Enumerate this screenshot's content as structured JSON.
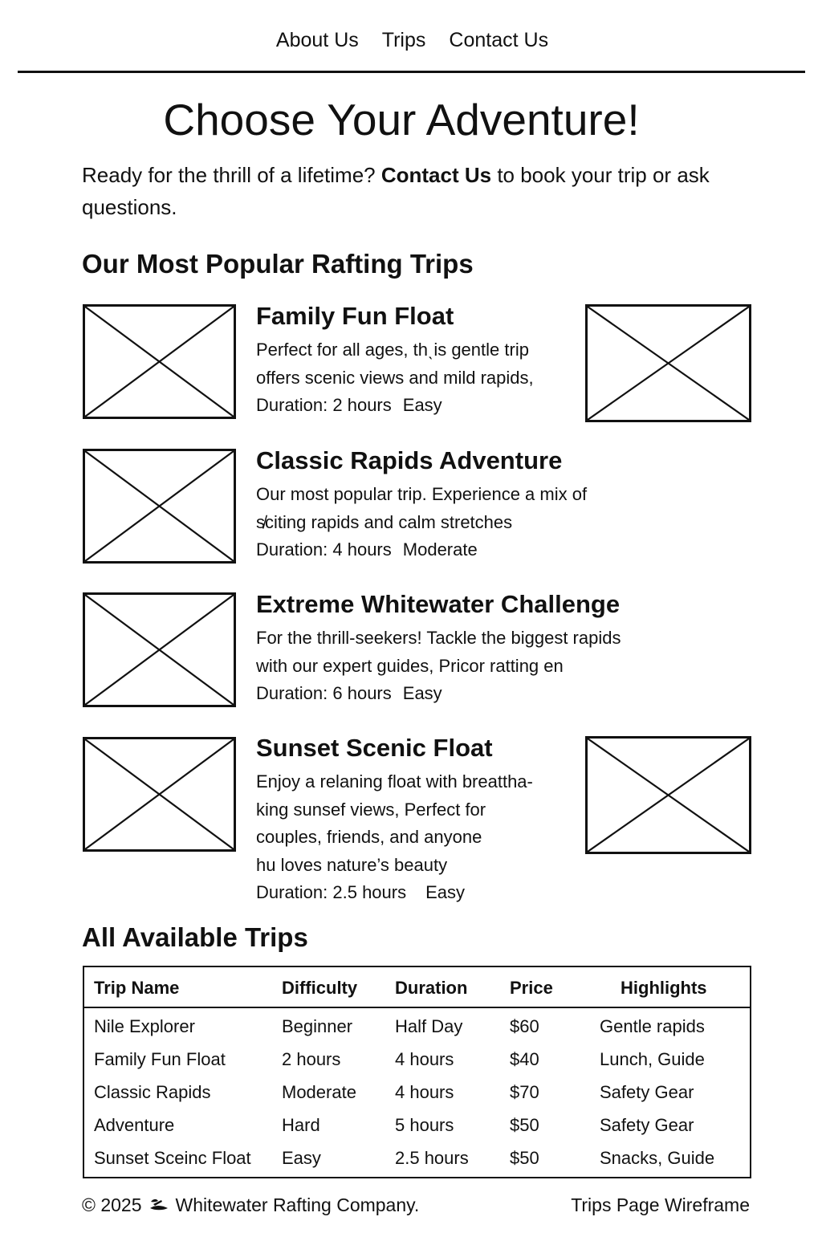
{
  "nav": {
    "items": [
      {
        "label": "About Us"
      },
      {
        "label": "Trips"
      },
      {
        "label": "Contact Us"
      }
    ]
  },
  "page": {
    "title": "Choose Your Adventure!",
    "intro_before": "Ready for the thrill of a lifetime? ",
    "intro_link": "Contact Us",
    "intro_after": " to book your trip or ask questions."
  },
  "popular": {
    "heading": "Our Most Popular Rafting Trips",
    "trips": [
      {
        "title": "Family Fun Float",
        "lines": [
          "Perfect for all ages, thˎis gentle trip",
          "offers scenic views and mild rapids,"
        ],
        "duration": "Duration: 2 hours",
        "difficulty": "Easy"
      },
      {
        "title": "Classic Rapids Adventure",
        "lines": [
          "Our most popular trip. Experience a mix of",
          "s̸citing rapids and calm stretches"
        ],
        "duration": "Duration: 4 hours",
        "difficulty": "Moderate"
      },
      {
        "title": "Extreme Whitewater Challenge",
        "lines": [
          "For the thrill-seekers! Tackle the biggest rapids",
          "with our expert guides, Pricor ratting en"
        ],
        "duration": "Duration: 6 hours",
        "difficulty": "Easy"
      },
      {
        "title": "Sunset Scenic Float",
        "lines": [
          "Enjoy a relaning float with breattha-",
          "king sunsef views, Perfect for",
          "couples, friends, and anyone",
          "hu loves nature’s beauty"
        ],
        "duration": "Duration: 2.5 hours",
        "difficulty": "Easy"
      }
    ]
  },
  "all_trips": {
    "heading": "All Available Trips",
    "columns": [
      "Trip Name",
      "Difficulty",
      "Duration",
      "Price",
      "Highlights"
    ],
    "rows": [
      [
        "Nile Explorer",
        "Beginner",
        "Half Day",
        "$60",
        "Gentle rapids"
      ],
      [
        "Family Fun Float",
        "2 hours",
        "4 hours",
        "$40",
        "Lunch, Guide"
      ],
      [
        "Classic Rapids",
        "Moderate",
        "4 hours",
        "$70",
        "Safety Gear"
      ],
      [
        "Adventure",
        "Hard",
        "5 hours",
        "$50",
        "Safety Gear"
      ],
      [
        "Sunset Sceinc Float",
        "Easy",
        "2.5 hours",
        "$50",
        "Snacks,  Guide"
      ]
    ]
  },
  "footer": {
    "copyright": "© 2025",
    "logo_icon": "raft-icon",
    "company": "Whitewater Rafting Company.",
    "right_text": "Trips Page Wireframe"
  }
}
